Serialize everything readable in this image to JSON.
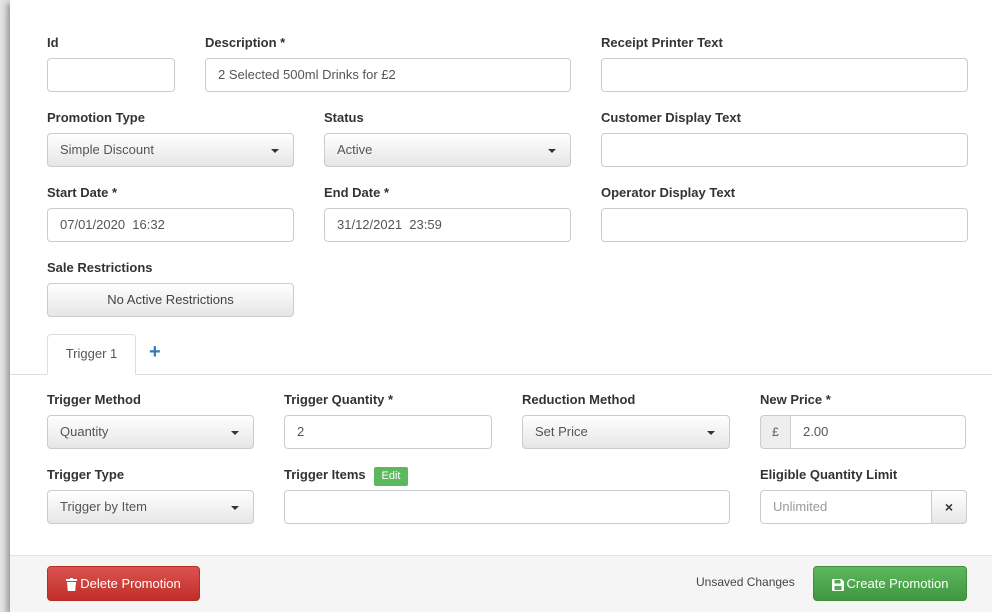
{
  "form": {
    "id": {
      "label": "Id",
      "value": ""
    },
    "description": {
      "label": "Description *",
      "value": "2 Selected 500ml Drinks for £2"
    },
    "receipt_printer_text": {
      "label": "Receipt Printer Text",
      "value": ""
    },
    "promotion_type": {
      "label": "Promotion Type",
      "value": "Simple Discount"
    },
    "status": {
      "label": "Status",
      "value": "Active"
    },
    "customer_display_text": {
      "label": "Customer Display Text",
      "value": ""
    },
    "start_date": {
      "label": "Start Date *",
      "value": "07/01/2020  16:32"
    },
    "end_date": {
      "label": "End Date *",
      "value": "31/12/2021  23:59"
    },
    "operator_display_text": {
      "label": "Operator Display Text",
      "value": ""
    },
    "sale_restrictions": {
      "label": "Sale Restrictions",
      "button": "No Active Restrictions"
    }
  },
  "tabs": [
    {
      "label": "Trigger 1",
      "active": true
    }
  ],
  "add_tab_icon": "plus-icon",
  "trigger": {
    "trigger_method": {
      "label": "Trigger Method",
      "value": "Quantity"
    },
    "trigger_quantity": {
      "label": "Trigger Quantity *",
      "value": "2"
    },
    "reduction_method": {
      "label": "Reduction Method",
      "value": "Set Price"
    },
    "new_price": {
      "label": "New Price *",
      "currency": "£",
      "value": "2.00"
    },
    "trigger_type": {
      "label": "Trigger Type",
      "value": "Trigger by Item"
    },
    "trigger_items": {
      "label": "Trigger Items",
      "edit_badge": "Edit",
      "value": ""
    },
    "eligible_quantity_limit": {
      "label": "Eligible Quantity Limit",
      "placeholder": "Unlimited",
      "clear": "×"
    }
  },
  "footer": {
    "delete_label": "Delete Promotion",
    "unsaved_text": "Unsaved Changes",
    "create_label": "Create Promotion"
  },
  "colors": {
    "danger": "#d9534f",
    "success": "#5cb85c",
    "link": "#337ab7"
  }
}
